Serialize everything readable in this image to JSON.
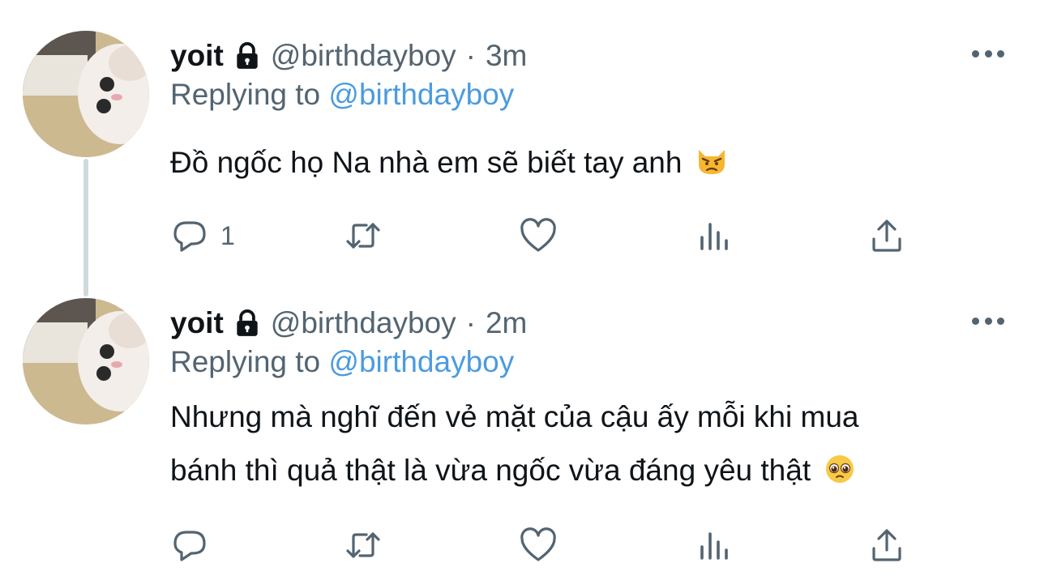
{
  "tweets": [
    {
      "display_name": "yoit",
      "handle": "@birthdayboy",
      "separator": "·",
      "time": "3m",
      "replying_prefix": "Replying to",
      "replying_handle": "@birthdayboy",
      "text_lines": [
        "Đồ ngốc họ Na nhà em sẽ biết tay anh"
      ],
      "emoji": "angry-cat-emoji",
      "reply_count": "1"
    },
    {
      "display_name": "yoit",
      "handle": "@birthdayboy",
      "separator": "·",
      "time": "2m",
      "replying_prefix": "Replying to",
      "replying_handle": "@birthdayboy",
      "text_lines": [
        "Nhưng mà nghĩ đến vẻ mặt của cậu ấy mỗi khi mua",
        "bánh thì quả thật là vừa ngốc vừa đáng yêu thật"
      ],
      "emoji": "pleading-face-emoji",
      "reply_count": ""
    }
  ],
  "icons": {
    "lock": "lock-icon",
    "more": "more-icon",
    "reply": "reply-icon",
    "retweet": "retweet-icon",
    "like": "heart-icon",
    "views": "views-icon",
    "share": "share-icon"
  },
  "colors": {
    "text": "#0f1419",
    "secondary": "#536471",
    "link": "#4b9be0",
    "thread_line": "#cfd9de"
  }
}
